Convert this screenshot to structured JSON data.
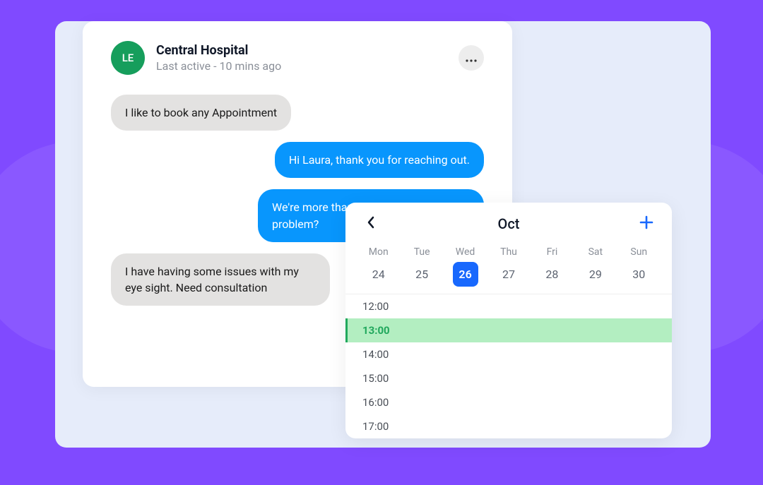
{
  "chat": {
    "avatar_initials": "LE",
    "title": "Central Hospital",
    "subtitle": "Last active - 10 mins ago",
    "more_icon": "more-icon",
    "messages": [
      {
        "side": "received",
        "text": "I like to book any Appointment"
      },
      {
        "side": "sent",
        "text": "Hi Laura, thank you for reaching out."
      },
      {
        "side": "sent",
        "text": "We're more than happy to help problem?"
      },
      {
        "side": "received",
        "text": "I have having some issues with my eye sight. Need consultation"
      }
    ]
  },
  "calendar": {
    "month": "Oct",
    "day_names": [
      "Mon",
      "Tue",
      "Wed",
      "Thu",
      "Fri",
      "Sat",
      "Sun"
    ],
    "days": [
      {
        "num": "24",
        "selected": false
      },
      {
        "num": "25",
        "selected": false
      },
      {
        "num": "26",
        "selected": true
      },
      {
        "num": "27",
        "selected": false
      },
      {
        "num": "28",
        "selected": false
      },
      {
        "num": "29",
        "selected": false
      },
      {
        "num": "30",
        "selected": false
      }
    ],
    "times": [
      {
        "label": "12:00",
        "selected": false
      },
      {
        "label": "13:00",
        "selected": true
      },
      {
        "label": "14:00",
        "selected": false
      },
      {
        "label": "15:00",
        "selected": false
      },
      {
        "label": "16:00",
        "selected": false
      },
      {
        "label": "17:00",
        "selected": false
      }
    ]
  },
  "colors": {
    "background": "#804aff",
    "sent_bubble": "#0896fd",
    "received_bubble": "#e3e2e1",
    "avatar": "#169e5c",
    "day_selected": "#1868fd",
    "time_selected_bg": "#b3eec1",
    "time_selected_accent": "#21a85d"
  }
}
